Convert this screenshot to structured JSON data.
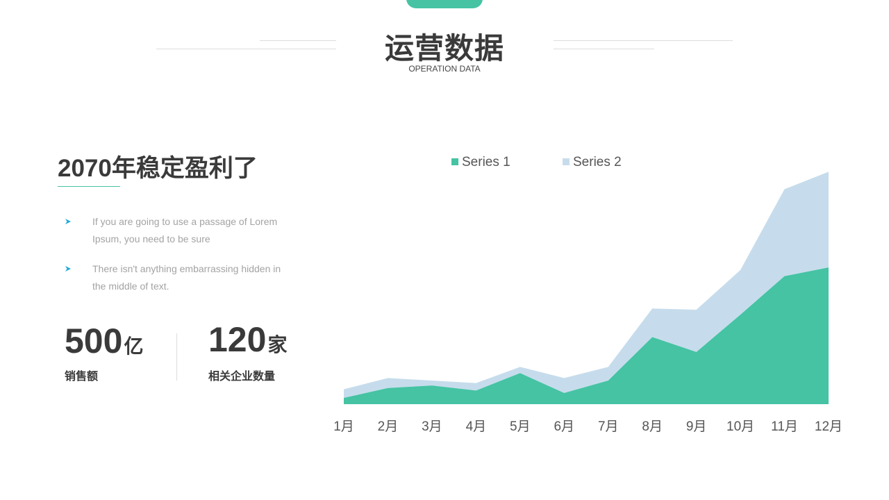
{
  "header": {
    "title": "运营数据",
    "subtitle": "OPERATION DATA"
  },
  "left_panel": {
    "heading": "2070年稳定盈利了",
    "bullets": [
      {
        "line1": "If you are going to use a passage of Lorem",
        "line2": "Ipsum, you need to be sure"
      },
      {
        "line1": "There isn't anything embarrassing hidden in",
        "line2": "the middle of text."
      }
    ],
    "stats": [
      {
        "number": "500",
        "unit": "亿",
        "label": "销售额"
      },
      {
        "number": "120",
        "unit": "家",
        "label": "相关企业数量"
      }
    ]
  },
  "colors": {
    "accent": "#45c3a3",
    "series2": "#c6dcec",
    "text_dark": "#3a3a3a",
    "text_light": "#a3a3a3"
  },
  "icons": {
    "bullet": "arrow-right-icon"
  },
  "chart_data": {
    "type": "area",
    "stacked": true,
    "categories": [
      "1月",
      "2月",
      "3月",
      "4月",
      "5月",
      "6月",
      "7月",
      "8月",
      "9月",
      "10月",
      "11月",
      "12月"
    ],
    "series": [
      {
        "name": "Series 1",
        "color": "#45c3a3",
        "values": [
          2.5,
          6.5,
          7.5,
          5.5,
          12.5,
          4.5,
          9.5,
          27,
          21,
          36,
          51.5,
          55
        ]
      },
      {
        "name": "Series 2",
        "color": "#c6dcec",
        "values": [
          3.5,
          4,
          2,
          3,
          2.5,
          6,
          5.5,
          11.5,
          17,
          18,
          35,
          38.5
        ]
      }
    ],
    "ylim": [
      0,
      95
    ],
    "legend": "top",
    "grid": false
  }
}
